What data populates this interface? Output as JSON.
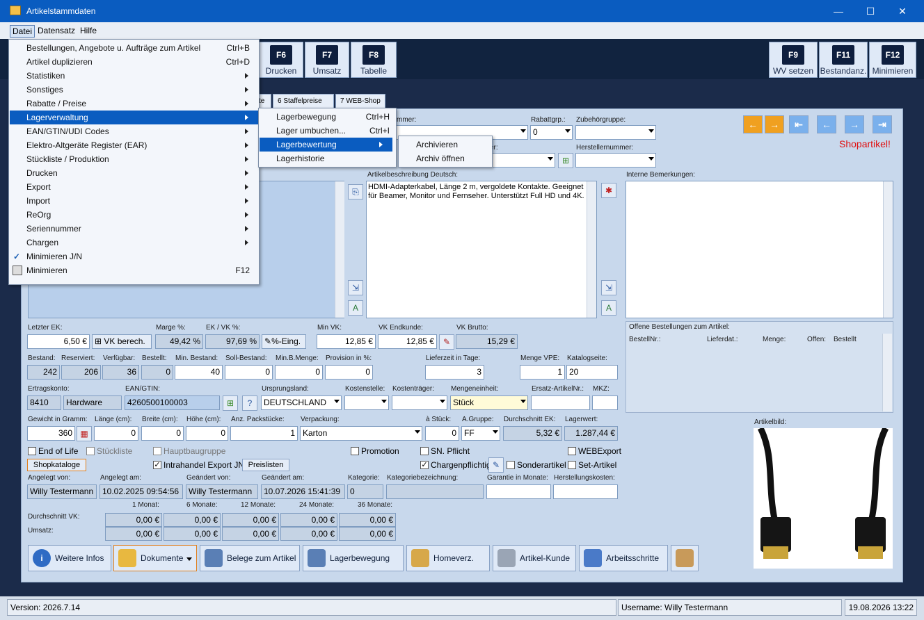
{
  "window": {
    "title": "Artikelstammdaten",
    "minimize": "—",
    "maximize": "☐",
    "close": "✕"
  },
  "menubar": {
    "items": [
      "Datei",
      "Datensatz",
      "Hilfe"
    ]
  },
  "toolbar": {
    "keys": [
      {
        "key": "F6",
        "label": "Drucken"
      },
      {
        "key": "F7",
        "label": "Umsatz"
      },
      {
        "key": "F8",
        "label": "Tabelle"
      },
      {
        "key": "F9",
        "label": "WV setzen"
      },
      {
        "key": "F11",
        "label": "Bestandanz."
      },
      {
        "key": "F12",
        "label": "Minimieren"
      }
    ]
  },
  "tabs": [
    "te",
    "6 Staffelpreise",
    "7 WEB-Shop"
  ],
  "menu_datei": {
    "items": [
      {
        "label": "Bestellungen, Angebote u. Aufträge zum Artikel",
        "shortcut": "Ctrl+B"
      },
      {
        "label": "Artikel duplizieren",
        "shortcut": "Ctrl+D"
      },
      {
        "label": "Statistiken"
      },
      {
        "label": "Sonstiges"
      },
      {
        "label": "Rabatte / Preise"
      },
      {
        "label": "Lagerverwaltung"
      },
      {
        "label": "EAN/GTIN/UDI Codes"
      },
      {
        "label": "Elektro-Altgeräte Register (EAR)"
      },
      {
        "label": "Stückliste / Produktion"
      },
      {
        "label": "Drucken"
      },
      {
        "label": "Export"
      },
      {
        "label": "Import"
      },
      {
        "label": "ReOrg"
      },
      {
        "label": "Seriennummer"
      },
      {
        "label": "Chargen"
      },
      {
        "label": "Minimieren J/N"
      },
      {
        "label": "Minimieren",
        "shortcut": "F12"
      }
    ]
  },
  "menu_lager": {
    "items": [
      {
        "label": "Lagerbewegung",
        "shortcut": "Ctrl+H"
      },
      {
        "label": "Lager umbuchen...",
        "shortcut": "Ctrl+I"
      },
      {
        "label": "Lagerbewertung"
      },
      {
        "label": "Lagerhistorie"
      }
    ]
  },
  "menu_bewertung": {
    "items": [
      "Archivieren",
      "Archiv öffnen"
    ]
  },
  "form": {
    "top_labels": {
      "nummer": "mmer:",
      "rabattgrp": "Rabattgrp.:",
      "zubehoer": "Zubehörgruppe:",
      "er": "er:",
      "herstellernr": "Herstellernummer:"
    },
    "rabattgrp_value": "0",
    "shop_flag": "Shopartikel!",
    "desc_label": "Artikelbeschreibung Deutsch:",
    "description": "HDMI-Adapterkabel, Länge 2 m, vergoldete Kontakte. Geeignet für Beamer, Monitor und Fernseher. Unterstützt Full HD und 4K.",
    "intern_label": "Interne Bemerkungen:",
    "offene_label": "Offene Bestellungen zum Artikel:",
    "offene_cols": [
      "BestellNr.:",
      "Lieferdat.:",
      "Menge:",
      "Offen:",
      "Bestellt"
    ],
    "letzter_ek_label": "Letzter EK:",
    "letzter_ek": "6,50 €",
    "vk_berech": "VK berech.",
    "marge_label": "Marge %:",
    "marge": "49,42 %",
    "ekvk_label": "EK / VK %:",
    "ekvk": "97,69 %",
    "prozent_eing": "%-Eing.",
    "minvk_label": "Min VK:",
    "minvk": "12,85 €",
    "vkend_label": "VK Endkunde:",
    "vkend": "12,85 €",
    "vkbrutto_label": "VK Brutto:",
    "vkbrutto": "15,29 €",
    "bestand_label": "Bestand:",
    "bestand": "242",
    "reserviert_label": "Reserviert:",
    "reserviert": "206",
    "verfuegbar_label": "Verfügbar:",
    "verfuegbar": "36",
    "bestellt_label": "Bestellt:",
    "bestellt": "0",
    "minbestand_label": "Min. Bestand:",
    "minbestand": "40",
    "sollbestand_label": "Soll-Bestand:",
    "sollbestand": "0",
    "minbmenge_label": "Min.B.Menge:",
    "minbmenge": "0",
    "provision_label": "Provision in %:",
    "provision": "0",
    "lieferzeit_label": "Lieferzeit in Tage:",
    "lieferzeit": "3",
    "mengevpe_label": "Menge VPE:",
    "mengevpe": "1",
    "katalog_label": "Katalogseite:",
    "katalog": "20",
    "ertrag_label": "Ertragskonto:",
    "ertrag_nr": "8410",
    "ertrag_name": "Hardware",
    "ean_label": "EAN/GTIN:",
    "ean": "4260500100003",
    "ursprung_label": "Ursprungsland:",
    "ursprung": "DEUTSCHLAND",
    "kostenstelle_label": "Kostenstelle:",
    "kostentraeger_label": "Kostenträger:",
    "mengeneinheit_label": "Mengeneinheit:",
    "mengeneinheit": "Stück",
    "ersatz_label": "Ersatz-ArtikelNr.:",
    "mkz_label": "MKZ:",
    "gewicht_label": "Gewicht in Gramm:",
    "gewicht": "360",
    "laenge_label": "Länge (cm):",
    "laenge": "0",
    "breite_label": "Breite (cm):",
    "breite": "0",
    "hoehe_label": "Höhe (cm):",
    "hoehe": "0",
    "packst_label": "Anz. Packstücke:",
    "packst": "1",
    "verpackung_label": "Verpackung:",
    "verpackung": "Karton",
    "astueck_label": "à Stück:",
    "astueck": "0",
    "agruppe_label": "A.Gruppe:",
    "agruppe": "FF",
    "dek_label": "Durchschnitt EK:",
    "dek": "5,32 €",
    "lagerwert_label": "Lagerwert:",
    "lagerwert": "1.287,44 €",
    "checks": {
      "eol": "End of Life",
      "stueckliste": "Stückliste",
      "hauptbau": "Hauptbaugruppe",
      "promotion": "Promotion",
      "sn": "SN. Pflicht",
      "webexport": "WEBExport",
      "intrahandel": "Intrahandel Export JN",
      "charge": "Chargenpflichtig",
      "sonder": "Sonderartikel",
      "set": "Set-Artikel"
    },
    "shopkataloge": "Shopkataloge",
    "preislisten": "Preislisten",
    "angelegt_von_label": "Angelegt von:",
    "angelegt_von": "Willy Testermann",
    "angelegt_am_label": "Angelegt am:",
    "angelegt_am": "10.02.2025 09:54:56",
    "geaendert_von_label": "Geändert von:",
    "geaendert_von": "Willy Testermann",
    "geaendert_am_label": "Geändert am:",
    "geaendert_am": "10.07.2026 15:41:39",
    "kategorie_label": "Kategorie:",
    "kategorie": "0",
    "katbez_label": "Kategoriebezeichnung:",
    "garantie_label": "Garantie in Monate:",
    "herstkosten_label": "Herstellungskosten:",
    "monat_headers": [
      "1 Monat:",
      "6 Monate:",
      "12 Monate:",
      "24 Monate:",
      "36 Monate:"
    ],
    "dvk_label": "Durchschnitt VK:",
    "umsatz_label": "Umsatz:",
    "dvk_values": [
      "0,00 €",
      "0,00 €",
      "0,00 €",
      "0,00 €",
      "0,00 €"
    ],
    "umsatz_values": [
      "0,00 €",
      "0,00 €",
      "0,00 €",
      "0,00 €",
      "0,00 €"
    ],
    "artikelbild_label": "Artikelbild:"
  },
  "bottom_buttons": [
    "Weitere Infos",
    "Dokumente",
    "Belege zum Artikel",
    "Lagerbewegung",
    "Homeverz.",
    "Artikel-Kunde",
    "Arbeitsschritte"
  ],
  "status": {
    "version": "Version: 2026.7.14",
    "user": "Username: Willy Testermann",
    "datetime": "19.08.2026 13:22"
  },
  "colors": {
    "accent": "#0a5cc0",
    "nav_orange": "#f0a020",
    "nav_blue": "#7ab0ec",
    "shop_red": "#e01010"
  }
}
